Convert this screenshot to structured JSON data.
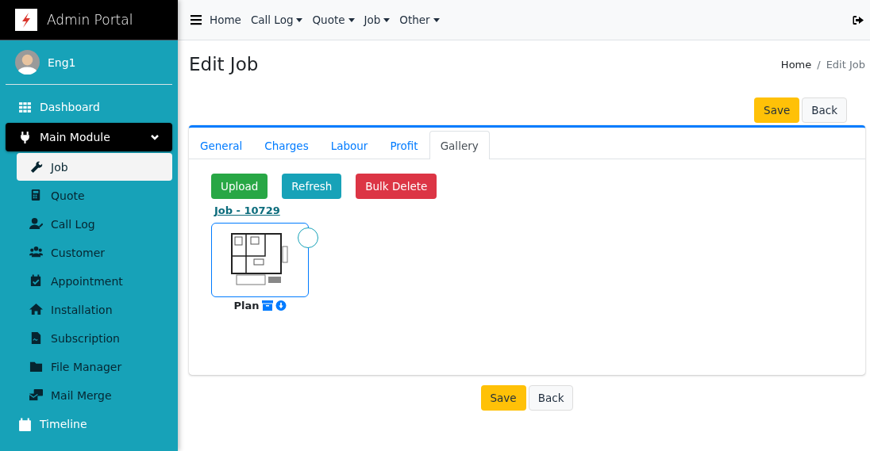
{
  "brand": {
    "title": "Admin Portal"
  },
  "user": {
    "name": "Eng1"
  },
  "sidebar": {
    "items": [
      {
        "label": "Dashboard",
        "selected": false
      },
      {
        "label": "Main Module",
        "selected": true,
        "expanded": true,
        "children": [
          {
            "label": "Job",
            "selected": true
          },
          {
            "label": "Quote",
            "selected": false
          },
          {
            "label": "Call Log",
            "selected": false
          },
          {
            "label": "Customer",
            "selected": false
          },
          {
            "label": "Appointment",
            "selected": false
          },
          {
            "label": "Installation",
            "selected": false
          },
          {
            "label": "Subscription",
            "selected": false
          },
          {
            "label": "File Manager",
            "selected": false
          },
          {
            "label": "Mail Merge",
            "selected": false
          }
        ]
      },
      {
        "label": "Timeline",
        "selected": false
      }
    ]
  },
  "navbar": {
    "items": [
      {
        "label": "Home",
        "dropdown": false
      },
      {
        "label": "Call Log",
        "dropdown": true
      },
      {
        "label": "Quote",
        "dropdown": true
      },
      {
        "label": "Job",
        "dropdown": true
      },
      {
        "label": "Other",
        "dropdown": true
      }
    ]
  },
  "page": {
    "title": "Edit Job",
    "breadcrumb": [
      "Home",
      "Edit Job"
    ],
    "breadcrumb_separator": "/"
  },
  "top_buttons": [
    {
      "label": "Save",
      "kind": "warning"
    },
    {
      "label": "Back",
      "kind": "light"
    }
  ],
  "tabs": [
    {
      "label": "General",
      "selected": false
    },
    {
      "label": "Charges",
      "selected": false
    },
    {
      "label": "Labour",
      "selected": false
    },
    {
      "label": "Profit",
      "selected": false
    },
    {
      "label": "Gallery",
      "selected": true
    }
  ],
  "gallery": {
    "buttons": [
      {
        "label": "Upload",
        "kind": "success"
      },
      {
        "label": "Refresh",
        "kind": "info"
      },
      {
        "label": "Bulk Delete",
        "kind": "danger"
      }
    ],
    "job_link": "Job - 10729",
    "items": [
      {
        "caption": "Plan",
        "selected": false,
        "kind": "picture"
      }
    ]
  },
  "bottom_buttons": [
    {
      "label": "Save",
      "kind": "warning"
    },
    {
      "label": "Back",
      "kind": "light"
    }
  ]
}
